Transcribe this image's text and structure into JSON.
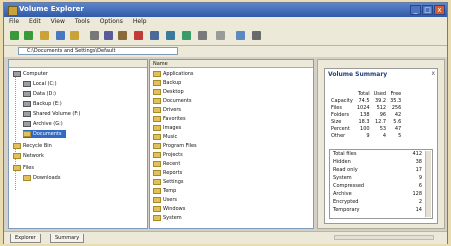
{
  "window": {
    "title": "Volume Explorer"
  },
  "menu": [
    "File",
    "Edit",
    "View",
    "Tools",
    "Options",
    "Help"
  ],
  "toolbar_icons": [
    "back-icon",
    "forward-icon",
    "up-icon",
    "refresh-icon",
    "folder-icon",
    "cut-icon",
    "copy-icon",
    "paste-icon",
    "delete-icon",
    "properties-icon",
    "view-icon",
    "chart-icon",
    "sort-icon",
    "filter-icon",
    "find-icon",
    "settings-icon"
  ],
  "address": {
    "value": "C:\\Documents and Settings\\Default"
  },
  "tree": {
    "items": [
      {
        "label": "Computer",
        "kind": "drive"
      },
      {
        "label": "Local (C:)",
        "kind": "drive"
      },
      {
        "label": "Data (D:)",
        "kind": "drive"
      },
      {
        "label": "Backup (E:)",
        "kind": "drive"
      },
      {
        "label": "Shared Volume (F:)",
        "kind": "drive"
      },
      {
        "label": "Archive (G:)",
        "kind": "drive"
      },
      {
        "label": "Documents",
        "kind": "folder",
        "selected": true
      },
      {
        "label": "Recycle Bin",
        "kind": "folder"
      },
      {
        "label": "Network",
        "kind": "folder"
      },
      {
        "label": "Files",
        "kind": "folder"
      },
      {
        "label": "Downloads",
        "kind": "folder"
      }
    ]
  },
  "files": {
    "header": "Name",
    "items": [
      "Applications",
      "Backup",
      "Desktop",
      "Documents",
      "Drivers",
      "Favorites",
      "Images",
      "Music",
      "Program Files",
      "Projects",
      "Recent",
      "Reports",
      "Settings",
      "Temp",
      "Users",
      "Windows",
      "System"
    ]
  },
  "side": {
    "title": "Volume Summary",
    "close": "x",
    "columns": [
      "",
      "Total",
      "Used",
      "Free"
    ],
    "rows": [
      [
        "Capacity",
        "74.5",
        "39.2",
        "35.3"
      ],
      [
        "Files",
        "1024",
        "512",
        "256"
      ],
      [
        "Folders",
        "138",
        "96",
        "42"
      ],
      [
        "Size",
        "18.3",
        "12.7",
        "5.6"
      ],
      [
        "Percent",
        "100",
        "53",
        "47"
      ],
      [
        "Other",
        "9",
        "4",
        "5"
      ]
    ],
    "breakdown": [
      {
        "label": "Total files",
        "value": "412"
      },
      {
        "label": "Hidden",
        "value": "38"
      },
      {
        "label": "Read only",
        "value": "17"
      },
      {
        "label": "System",
        "value": "9"
      },
      {
        "label": "Compressed",
        "value": "6"
      },
      {
        "label": "Archive",
        "value": "128"
      },
      {
        "label": "Encrypted",
        "value": "2"
      },
      {
        "label": "Temporary",
        "value": "14"
      }
    ]
  },
  "status": {
    "tabs": [
      "Explorer",
      "Summary"
    ]
  },
  "colors": {
    "titlebar": "#2f5aa8",
    "selection": "#316ac5",
    "folder": "#e2c15a",
    "background": "#e8dcb0"
  }
}
